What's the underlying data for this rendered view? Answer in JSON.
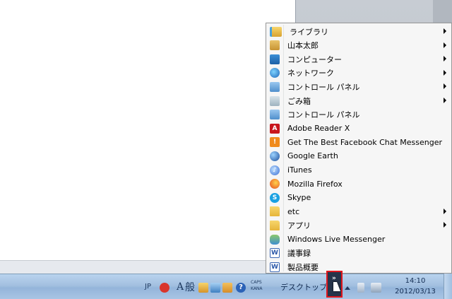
{
  "menu": {
    "items": [
      {
        "label": "ライブラリ",
        "icon": "library-icon",
        "submenu": true
      },
      {
        "label": "山本太郎",
        "icon": "user-folder-icon",
        "submenu": true
      },
      {
        "label": "コンピューター",
        "icon": "computer-icon",
        "submenu": true
      },
      {
        "label": "ネットワーク",
        "icon": "network-icon",
        "submenu": true
      },
      {
        "label": "コントロール パネル",
        "icon": "control-panel-icon",
        "submenu": true
      },
      {
        "label": "ごみ箱",
        "icon": "recycle-bin-icon",
        "submenu": true
      },
      {
        "label": "コントロール パネル",
        "icon": "control-panel-icon",
        "submenu": false
      },
      {
        "label": "Adobe Reader X",
        "icon": "adobe-reader-icon",
        "submenu": false
      },
      {
        "label": "Get The Best Facebook Chat Messenger",
        "icon": "facebook-messenger-icon",
        "submenu": false
      },
      {
        "label": "Google Earth",
        "icon": "google-earth-icon",
        "submenu": false
      },
      {
        "label": "iTunes",
        "icon": "itunes-icon",
        "submenu": false
      },
      {
        "label": "Mozilla Firefox",
        "icon": "firefox-icon",
        "submenu": false
      },
      {
        "label": "Skype",
        "icon": "skype-icon",
        "submenu": false
      },
      {
        "label": "etc",
        "icon": "folder-icon",
        "submenu": true
      },
      {
        "label": "アプリ",
        "icon": "folder-icon",
        "submenu": true
      },
      {
        "label": "Windows Live Messenger",
        "icon": "windows-live-messenger-icon",
        "submenu": false
      },
      {
        "label": "議事録",
        "icon": "word-document-icon",
        "submenu": false
      },
      {
        "label": "製品概要",
        "icon": "word-document-icon",
        "submenu": false
      }
    ]
  },
  "taskbar": {
    "language": "JP",
    "ime_mode": "A",
    "ime_kanji": "般",
    "caps": "CAPS",
    "kana": "KANA",
    "desktop_toolbar": "デスクトップ",
    "chevron": "»",
    "clock_time": "14:10",
    "clock_date": "2012/03/13"
  },
  "colors": {
    "highlight_border": "#e0161d",
    "taskbar": "#a3c0e0"
  }
}
